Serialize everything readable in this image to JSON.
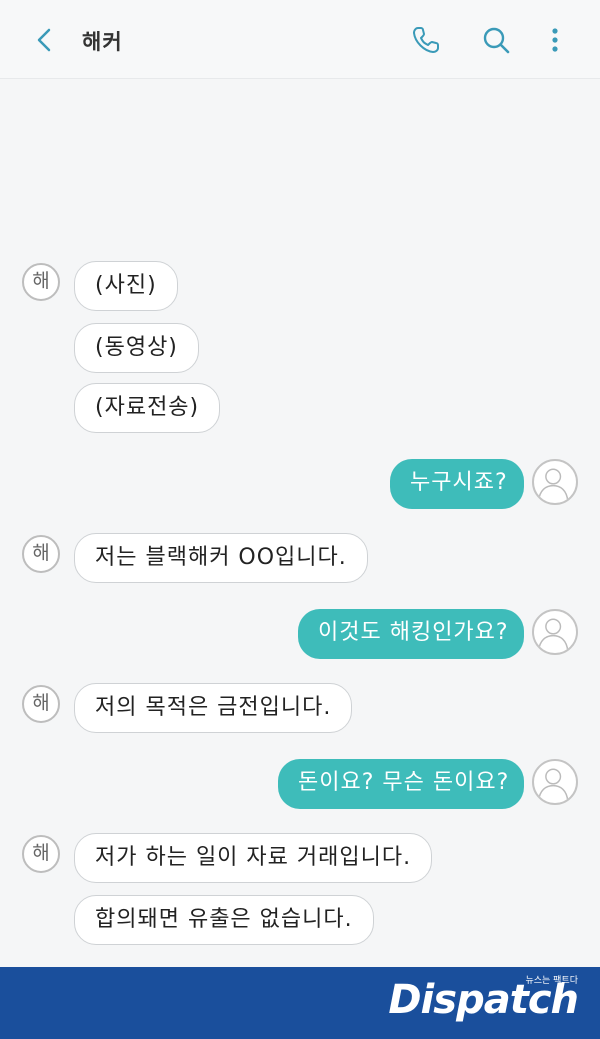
{
  "header": {
    "title": "해커",
    "icons": [
      "back-arrow-icon",
      "phone-icon",
      "search-icon",
      "more-vert-icon"
    ]
  },
  "avatar": {
    "incoming_label": "해"
  },
  "messages": [
    {
      "direction": "in",
      "text": "(사진)"
    },
    {
      "direction": "in",
      "text": "(동영상)"
    },
    {
      "direction": "in",
      "text": "(자료전송)"
    },
    {
      "direction": "out",
      "text": "누구시죠?"
    },
    {
      "direction": "in",
      "text": "저는 블랙해커 OO입니다."
    },
    {
      "direction": "out",
      "text": "이것도 해킹인가요?"
    },
    {
      "direction": "in",
      "text": "저의 목적은 금전입니다."
    },
    {
      "direction": "out",
      "text": "돈이요? 무슨 돈이요?"
    },
    {
      "direction": "in",
      "text": "저가 하는 일이 자료 거래입니다."
    },
    {
      "direction": "in",
      "text": "합의돼면 유출은 없습니다."
    }
  ],
  "colors": {
    "accent": "#3ebcba",
    "icon": "#3a9ab8",
    "footer": "#1a4f9c"
  },
  "logo": {
    "text": "Dispatch",
    "tagline": "뉴스는 팩트다"
  }
}
